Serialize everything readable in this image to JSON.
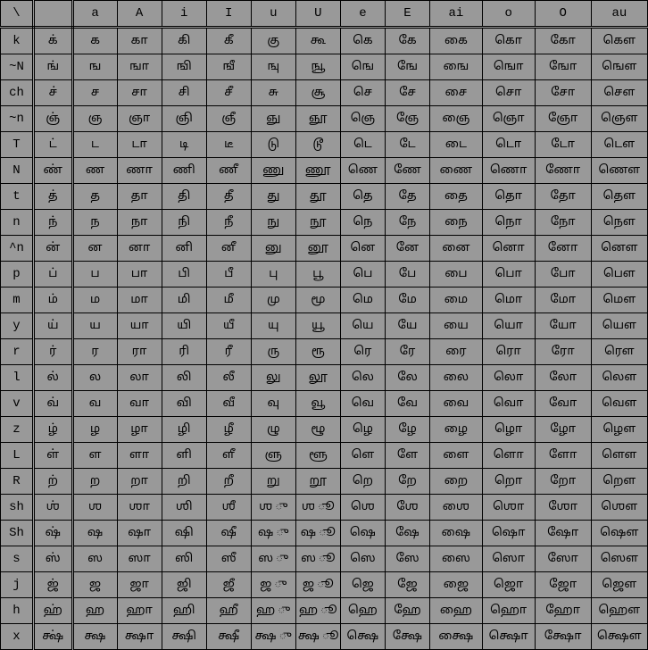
{
  "header": [
    "\\",
    "",
    "a",
    "A",
    "i",
    "I",
    "u",
    "U",
    "e",
    "E",
    "ai",
    "o",
    "O",
    "au"
  ],
  "rows": [
    {
      "label": "k",
      "cells": [
        "க்",
        "க",
        "கா",
        "கி",
        "கீ",
        "கு",
        "கூ",
        "கெ",
        "கே",
        "கை",
        "கொ",
        "கோ",
        "கௌ"
      ]
    },
    {
      "label": "~N",
      "cells": [
        "ங்",
        "ங",
        "ஙா",
        "ஙி",
        "ஙீ",
        "ஙு",
        "ஙூ",
        "ஙெ",
        "ஙே",
        "ஙை",
        "ஙொ",
        "ஙோ",
        "ஙௌ"
      ]
    },
    {
      "label": "ch",
      "cells": [
        "ச்",
        "ச",
        "சா",
        "சி",
        "சீ",
        "சு",
        "சூ",
        "செ",
        "சே",
        "சை",
        "சொ",
        "சோ",
        "சௌ"
      ]
    },
    {
      "label": "~n",
      "cells": [
        "ஞ்",
        "ஞ",
        "ஞா",
        "ஞி",
        "ஞீ",
        "ஞு",
        "ஞூ",
        "ஞெ",
        "ஞே",
        "ஞை",
        "ஞொ",
        "ஞோ",
        "ஞௌ"
      ]
    },
    {
      "label": "T",
      "cells": [
        "ட்",
        "ட",
        "டா",
        "டி",
        "டீ",
        "டு",
        "டூ",
        "டெ",
        "டே",
        "டை",
        "டொ",
        "டோ",
        "டௌ"
      ]
    },
    {
      "label": "N",
      "cells": [
        "ண்",
        "ண",
        "ணா",
        "ணி",
        "ணீ",
        "ணு",
        "ணூ",
        "ணெ",
        "ணே",
        "ணை",
        "ணொ",
        "ணோ",
        "ணௌ"
      ]
    },
    {
      "label": "t",
      "cells": [
        "த்",
        "த",
        "தா",
        "தி",
        "தீ",
        "து",
        "தூ",
        "தெ",
        "தே",
        "தை",
        "தொ",
        "தோ",
        "தௌ"
      ]
    },
    {
      "label": "n",
      "cells": [
        "ந்",
        "ந",
        "நா",
        "நி",
        "நீ",
        "நு",
        "நூ",
        "நெ",
        "நே",
        "நை",
        "நொ",
        "நோ",
        "நௌ"
      ]
    },
    {
      "label": "^n",
      "cells": [
        "ன்",
        "ன",
        "னா",
        "னி",
        "னீ",
        "னு",
        "னூ",
        "னெ",
        "னே",
        "னை",
        "னொ",
        "னோ",
        "னௌ"
      ]
    },
    {
      "label": "p",
      "cells": [
        "ப்",
        "ப",
        "பா",
        "பி",
        "பீ",
        "பு",
        "பூ",
        "பெ",
        "பே",
        "பை",
        "பொ",
        "போ",
        "பௌ"
      ]
    },
    {
      "label": "m",
      "cells": [
        "ம்",
        "ம",
        "மா",
        "மி",
        "மீ",
        "மு",
        "மூ",
        "மெ",
        "மே",
        "மை",
        "மொ",
        "மோ",
        "மௌ"
      ]
    },
    {
      "label": "y",
      "cells": [
        "ய்",
        "ய",
        "யா",
        "யி",
        "யீ",
        "யு",
        "யூ",
        "யெ",
        "யே",
        "யை",
        "யொ",
        "யோ",
        "யௌ"
      ]
    },
    {
      "label": "r",
      "cells": [
        "ர்",
        "ர",
        "ரா",
        "ரி",
        "ரீ",
        "ரு",
        "ரூ",
        "ரெ",
        "ரே",
        "ரை",
        "ரொ",
        "ரோ",
        "ரௌ"
      ]
    },
    {
      "label": "l",
      "cells": [
        "ல்",
        "ல",
        "லா",
        "லி",
        "லீ",
        "லு",
        "லூ",
        "லெ",
        "லே",
        "லை",
        "லொ",
        "லோ",
        "லௌ"
      ]
    },
    {
      "label": "v",
      "cells": [
        "வ்",
        "வ",
        "வா",
        "வி",
        "வீ",
        "வு",
        "வூ",
        "வெ",
        "வே",
        "வை",
        "வொ",
        "வோ",
        "வௌ"
      ]
    },
    {
      "label": "z",
      "cells": [
        "ழ்",
        "ழ",
        "ழா",
        "ழி",
        "ழீ",
        "ழு",
        "ழூ",
        "ழெ",
        "ழே",
        "ழை",
        "ழொ",
        "ழோ",
        "ழௌ"
      ]
    },
    {
      "label": "L",
      "cells": [
        "ள்",
        "ள",
        "ளா",
        "ளி",
        "ளீ",
        "ளு",
        "ளூ",
        "ளெ",
        "ளே",
        "ளை",
        "ளொ",
        "ளோ",
        "ளௌ"
      ]
    },
    {
      "label": "R",
      "cells": [
        "ற்",
        "ற",
        "றா",
        "றி",
        "றீ",
        "று",
        "றூ",
        "றெ",
        "றே",
        "றை",
        "றொ",
        "றோ",
        "றௌ"
      ]
    },
    {
      "label": "sh",
      "cells": [
        "ஶ்",
        "ஶ",
        "ஶா",
        "ஶி",
        "ஶீ",
        "ஶ ு",
        "ஶ ூ",
        "ஶெ",
        "ஶே",
        "ஶை",
        "ஶொ",
        "ஶோ",
        "ஶௌ"
      ]
    },
    {
      "label": "Sh",
      "cells": [
        "ஷ்",
        "ஷ",
        "ஷா",
        "ஷி",
        "ஷீ",
        "ஷ ு",
        "ஷ ூ",
        "ஷெ",
        "ஷே",
        "ஷை",
        "ஷொ",
        "ஷோ",
        "ஷௌ"
      ]
    },
    {
      "label": "s",
      "cells": [
        "ஸ்",
        "ஸ",
        "ஸா",
        "ஸி",
        "ஸீ",
        "ஸ ு",
        "ஸ ூ",
        "ஸெ",
        "ஸே",
        "ஸை",
        "ஸொ",
        "ஸோ",
        "ஸௌ"
      ]
    },
    {
      "label": "j",
      "cells": [
        "ஜ்",
        "ஜ",
        "ஜா",
        "ஜி",
        "ஜீ",
        "ஜ ு",
        "ஜ ூ",
        "ஜெ",
        "ஜே",
        "ஜை",
        "ஜொ",
        "ஜோ",
        "ஜௌ"
      ]
    },
    {
      "label": "h",
      "cells": [
        "ஹ்",
        "ஹ",
        "ஹா",
        "ஹி",
        "ஹீ",
        "ஹ ு",
        "ஹ ூ",
        "ஹெ",
        "ஹே",
        "ஹை",
        "ஹொ",
        "ஹோ",
        "ஹௌ"
      ]
    },
    {
      "label": "x",
      "cells": [
        "க்ஷ்",
        "க்ஷ",
        "க்ஷா",
        "க்ஷி",
        "க்ஷீ",
        "க்ஷ ு",
        "க்ஷ ூ",
        "க்ஷெ",
        "க்ஷே",
        "க்ஷை",
        "க்ஷொ",
        "க்ஷோ",
        "க்ஷௌ"
      ]
    }
  ]
}
